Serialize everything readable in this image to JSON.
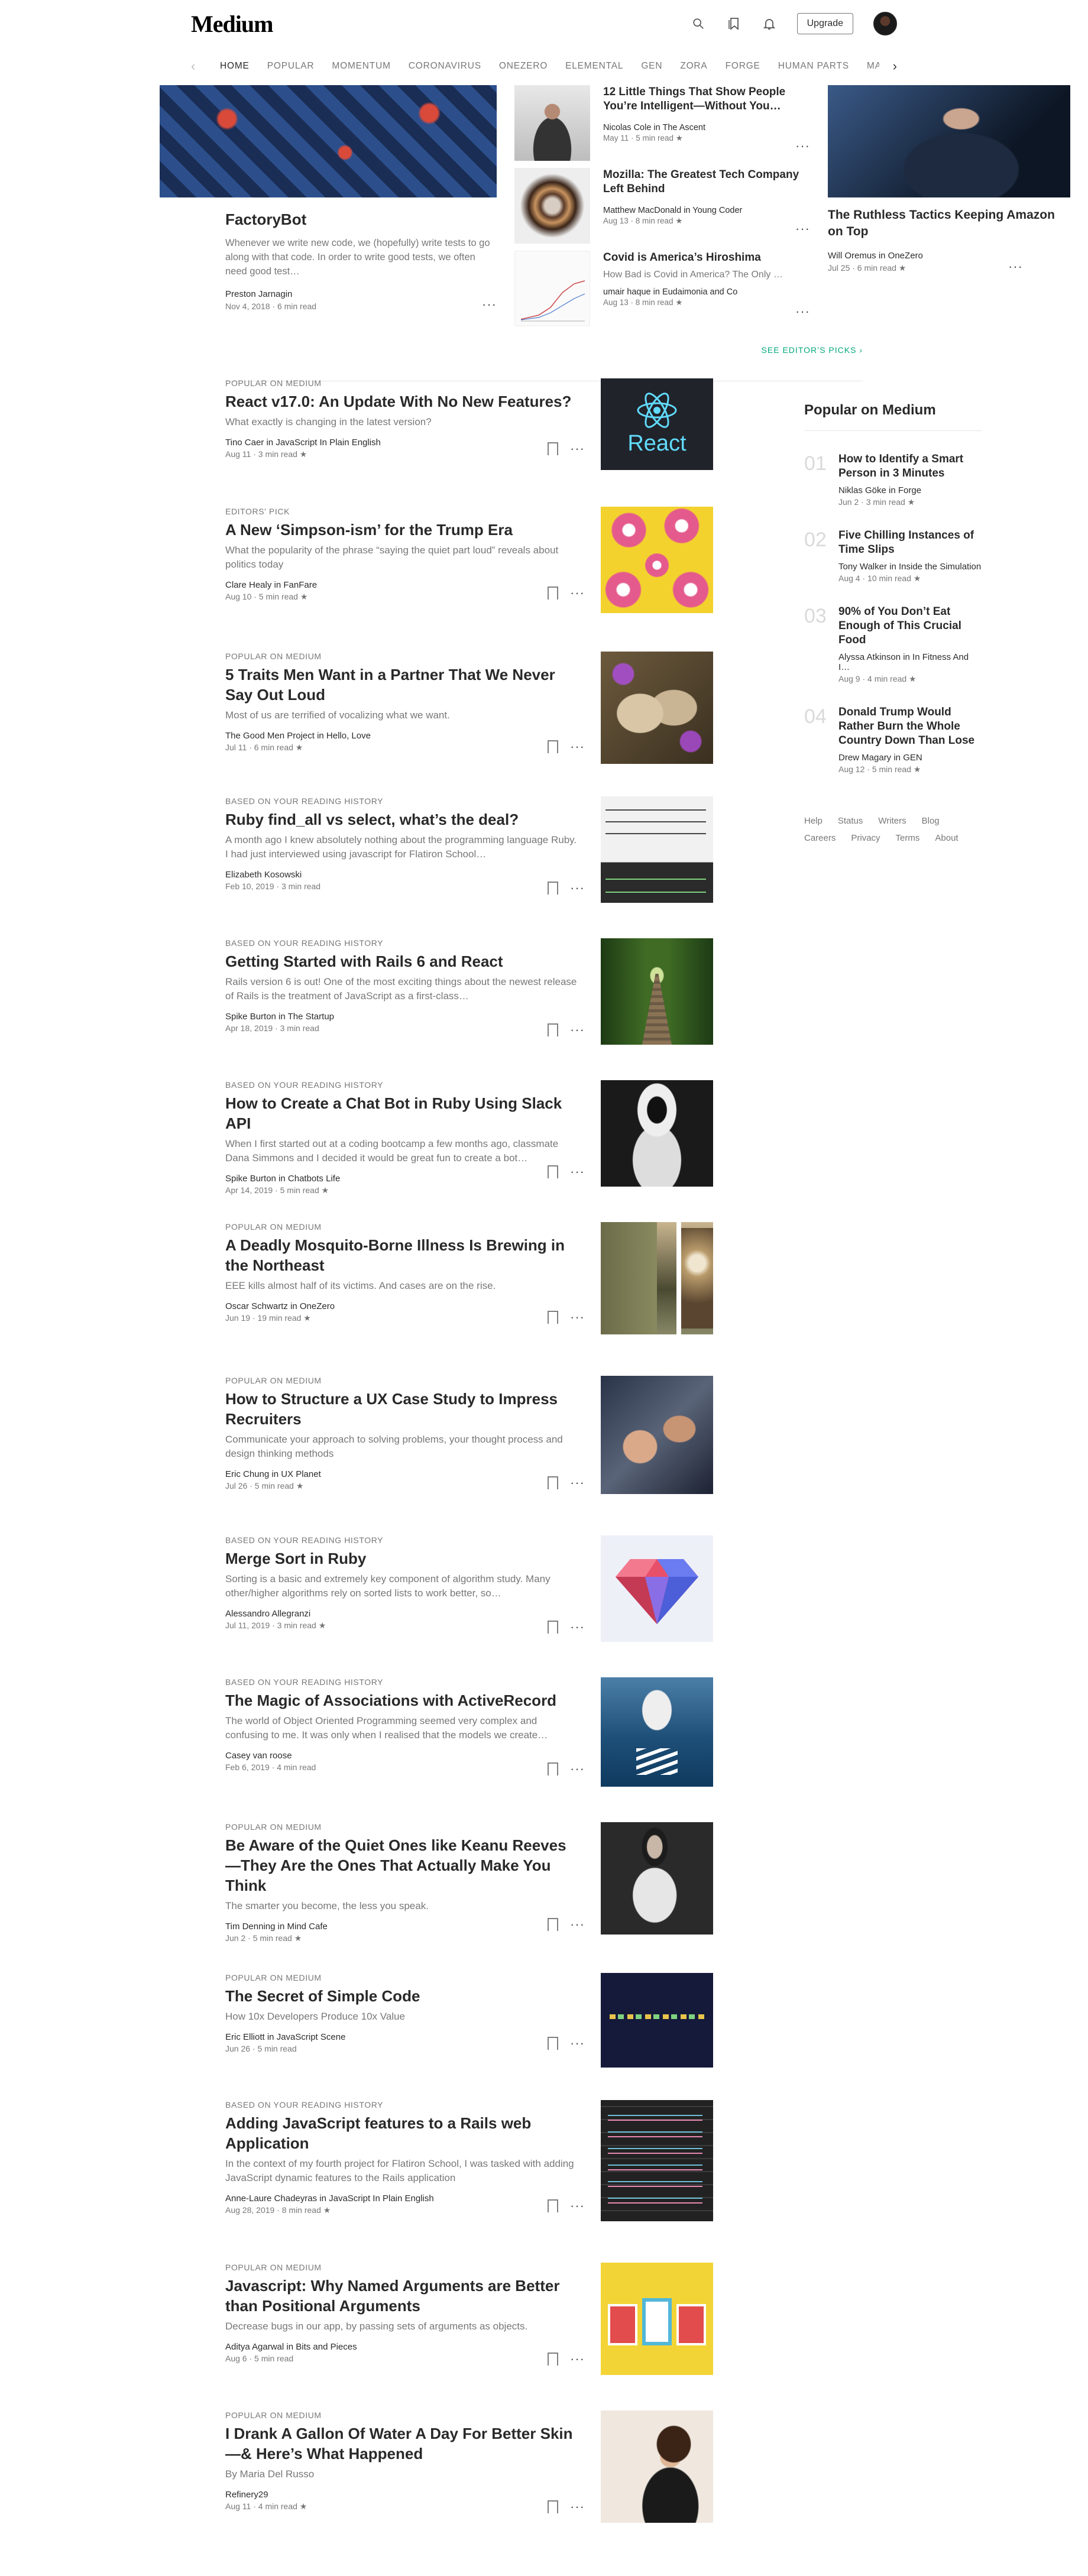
{
  "header": {
    "logo": "Medium",
    "upgrade_label": "Upgrade"
  },
  "nav": {
    "items": [
      "HOME",
      "POPULAR",
      "MOMENTUM",
      "CORONAVIRUS",
      "ONEZERO",
      "ELEMENTAL",
      "GEN",
      "ZORA",
      "FORGE",
      "HUMAN PARTS",
      "MARKER"
    ]
  },
  "hero": {
    "main": {
      "title": "FactoryBot",
      "subtitle": "Whenever we write new code, we (hopefully) write tests to go along with that code. In order to write good tests, we often need good test…",
      "author": "Preston Jarnagin",
      "date": "Nov 4, 2018 · 6 min read"
    },
    "middle": [
      {
        "title": "12 Little Things That Show People You’re Intelligent—Without You…",
        "author": "Nicolas Cole in The Ascent",
        "date": "May 11 · 5 min read ★"
      },
      {
        "title": "Mozilla: The Greatest Tech Company Left Behind",
        "author": "Matthew MacDonald in Young Coder",
        "date": "Aug 13 · 8 min read ★"
      },
      {
        "title": "Covid is America’s Hiroshima",
        "subtitle": "How Bad is Covid in America? The Only …",
        "author": "umair haque in Eudaimonia and Co",
        "date": "Aug 13 · 8 min read ★"
      }
    ],
    "right": {
      "title": "The Ruthless Tactics Keeping Amazon on Top",
      "author": "Will Oremus in OneZero",
      "date": "Jul 25 · 6 min read ★"
    },
    "see_picks": "SEE EDITOR’S PICKS ›"
  },
  "feed": [
    {
      "tag": "POPULAR ON MEDIUM",
      "title": "React v17.0: An Update With No New Features?",
      "subtitle": "What exactly is changing in the latest version?",
      "author": "Tino Caer in JavaScript In Plain English",
      "date": "Aug 11 · 3 min read ★",
      "image_text": "React"
    },
    {
      "tag": "EDITORS' PICK",
      "title": "A New ‘Simpson-ism’ for the Trump Era",
      "subtitle": "What the popularity of the phrase “saying the quiet part loud” reveals about politics today",
      "author": "Clare Healy in FanFare",
      "date": "Aug 10 · 5 min read ★"
    },
    {
      "tag": "POPULAR ON MEDIUM",
      "title": "5 Traits Men Want in a Partner That We Never Say Out Loud",
      "subtitle": "Most of us are terrified of vocalizing what we want.",
      "author": "The Good Men Project in Hello, Love",
      "date": "Jul 11 · 6 min read ★"
    },
    {
      "tag": "BASED ON YOUR READING HISTORY",
      "title": "Ruby find_all vs select, what’s the deal?",
      "subtitle": "A month ago I knew absolutely nothing about the programming language Ruby. I had just interviewed using javascript for Flatiron School…",
      "author": "Elizabeth Kosowski",
      "date": "Feb 10, 2019 · 3 min read"
    },
    {
      "tag": "BASED ON YOUR READING HISTORY",
      "title": "Getting Started with Rails 6 and React",
      "subtitle": "Rails version 6 is out! One of the most exciting things about the newest release of Rails is the treatment of JavaScript as a first-class…",
      "author": "Spike Burton in The Startup",
      "date": "Apr 18, 2019 · 3 min read"
    },
    {
      "tag": "BASED ON YOUR READING HISTORY",
      "title": "How to Create a Chat Bot in Ruby Using Slack API",
      "subtitle": "When I first started out at a coding bootcamp a few months ago, classmate Dana Simmons and I decided it would be great fun to create a bot…",
      "author": "Spike Burton in Chatbots Life",
      "date": "Apr 14, 2019 · 5 min read ★"
    },
    {
      "tag": "POPULAR ON MEDIUM",
      "title": "A Deadly Mosquito-Borne Illness Is Brewing in the Northeast",
      "subtitle": "EEE kills almost half of its victims. And cases are on the rise.",
      "author": "Oscar Schwartz in OneZero",
      "date": "Jun 19 · 19 min read ★"
    },
    {
      "tag": "POPULAR ON MEDIUM",
      "title": "How to Structure a UX Case Study to Impress Recruiters",
      "subtitle": "Communicate your approach to solving problems, your thought process and design thinking methods",
      "author": "Eric Chung in UX Planet",
      "date": "Jul 26 · 5 min read ★"
    },
    {
      "tag": "BASED ON YOUR READING HISTORY",
      "title": "Merge Sort in Ruby",
      "subtitle": "Sorting is a basic and extremely key component of algorithm study. Many other/higher algorithms rely on sorted lists to work better, so…",
      "author": "Alessandro Allegranzi",
      "date": "Jul 11, 2019 · 3 min read ★"
    },
    {
      "tag": "BASED ON YOUR READING HISTORY",
      "title": "The Magic of Associations with ActiveRecord",
      "subtitle": "The world of Object Oriented Programming seemed very complex and confusing to me. It was only when I realised that the models we create…",
      "author": "Casey van roose",
      "date": "Feb 6, 2019 · 4 min read"
    },
    {
      "tag": "POPULAR ON MEDIUM",
      "title": "Be Aware of the Quiet Ones like Keanu Reeves—They Are the Ones That Actually Make You Think",
      "subtitle": "The smarter you become, the less you speak.",
      "author": "Tim Denning in Mind Cafe",
      "date": "Jun 2 · 5 min read ★"
    },
    {
      "tag": "POPULAR ON MEDIUM",
      "title": "The Secret of Simple Code",
      "subtitle": "How 10x Developers Produce 10x Value",
      "author": "Eric Elliott in JavaScript Scene",
      "date": "Jun 26 · 5 min read"
    },
    {
      "tag": "BASED ON YOUR READING HISTORY",
      "title": "Adding JavaScript features to a Rails web Application",
      "subtitle": "In the context of my fourth project for Flatiron School, I was tasked with adding JavaScript dynamic features to the Rails application",
      "author": "Anne-Laure Chadeyras in JavaScript In Plain English",
      "date": "Aug 28, 2019 · 8 min read ★"
    },
    {
      "tag": "POPULAR ON MEDIUM",
      "title": "Javascript: Why Named Arguments are Better than Positional Arguments",
      "subtitle": "Decrease bugs in our app, by passing sets of arguments as objects.",
      "author": "Aditya Agarwal in Bits and Pieces",
      "date": "Aug 6 · 5 min read"
    },
    {
      "tag": "POPULAR ON MEDIUM",
      "title": "I Drank A Gallon Of Water A Day For Better Skin—& Here’s What Happened",
      "subtitle": "By Maria Del Russo",
      "author": "Refinery29",
      "date": "Aug 11 · 4 min read ★"
    }
  ],
  "sidebar": {
    "heading": "Popular on Medium",
    "items": [
      {
        "num": "01",
        "title": "How to Identify a Smart Person in 3 Minutes",
        "author": "Niklas Göke in Forge",
        "date": "Jun 2 · 3 min read ★"
      },
      {
        "num": "02",
        "title": "Five Chilling Instances of Time Slips",
        "author": "Tony Walker in Inside the Simulation",
        "date": "Aug 4 · 10 min read ★"
      },
      {
        "num": "03",
        "title": "90% of You Don’t Eat Enough of This Crucial Food",
        "author": "Alyssa Atkinson in In Fitness And I…",
        "date": "Aug 9 · 4 min read ★"
      },
      {
        "num": "04",
        "title": "Donald Trump Would Rather Burn the Whole Country Down Than Lose",
        "author": "Drew Magary in GEN",
        "date": "Aug 12 · 5 min read ★"
      }
    ],
    "footer": [
      "Help",
      "Status",
      "Writers",
      "Blog",
      "Careers",
      "Privacy",
      "Terms",
      "About"
    ]
  }
}
